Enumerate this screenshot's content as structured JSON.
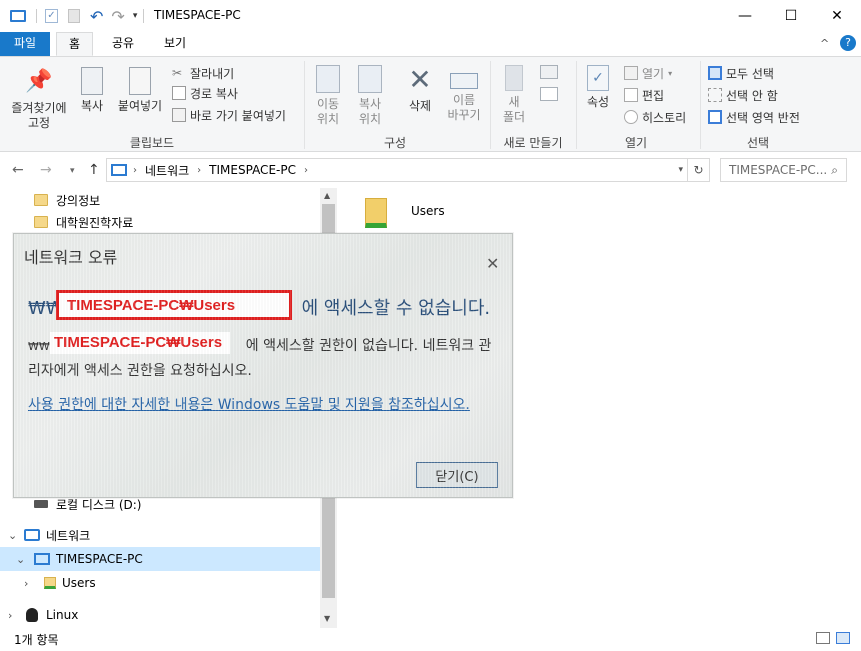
{
  "window": {
    "title": "TIMESPACE-PC",
    "minimize": "—",
    "maximize": "☐",
    "close": "✕"
  },
  "tabs": {
    "file": "파일",
    "home": "홈",
    "share": "공유",
    "view": "보기"
  },
  "ribbon": {
    "clipboard": {
      "label": "클립보드",
      "pin": "즐겨찾기에\n고정",
      "copy": "복사",
      "paste": "붙여넣기",
      "cut": "잘라내기",
      "copy_path": "경로 복사",
      "paste_shortcut": "바로 가기 붙여넣기"
    },
    "organize": {
      "label": "구성",
      "move_to": "이동\n위치",
      "copy_to": "복사\n위치",
      "delete": "삭제",
      "rename": "이름\n바꾸기"
    },
    "new": {
      "label": "새로 만들기",
      "new_folder": "새\n폴더"
    },
    "open": {
      "label": "열기",
      "properties": "속성",
      "open": "열기",
      "edit": "편집",
      "history": "히스토리"
    },
    "select": {
      "label": "선택",
      "select_all": "모두 선택",
      "select_none": "선택 안 함",
      "invert": "선택 영역 반전"
    }
  },
  "address": {
    "path": [
      "네트워크",
      "TIMESPACE-PC"
    ],
    "search_placeholder": "TIMESPACE-PC..."
  },
  "tree": {
    "items": [
      {
        "label": "강의정보"
      },
      {
        "label": "대학원진학자료"
      },
      {
        "label": "로컬 디스크 (D:)"
      },
      {
        "label": "네트워크"
      },
      {
        "label": "TIMESPACE-PC"
      },
      {
        "label": "Users"
      },
      {
        "label": "Linux"
      }
    ]
  },
  "content": {
    "items": [
      {
        "label": "Users"
      }
    ]
  },
  "status": {
    "count": "1개 항목"
  },
  "dialog": {
    "title": "네트워크 오류",
    "main_prefix": "₩₩",
    "main_suffix": "에 액세스할 수 없습니다.",
    "body_prefix": "₩₩",
    "body_line1_suffix": "에 액세스할 권한이 없습니다. 네트워크 관",
    "body_line2": "리자에게 액세스 권한을 요청하십시오.",
    "link": "사용 권한에 대한 자세한 내용은 Windows 도움말 및 지원을 참조하십시오.",
    "close_button": "닫기(C)",
    "redact_box1": "TIMESPACE-PC₩Users",
    "redact_box2": "TIMESPACE-PC₩Users"
  },
  "colors": {
    "file_tab": "#1979ca",
    "selected": "#cce8ff",
    "annotation_red": "#e02020"
  }
}
